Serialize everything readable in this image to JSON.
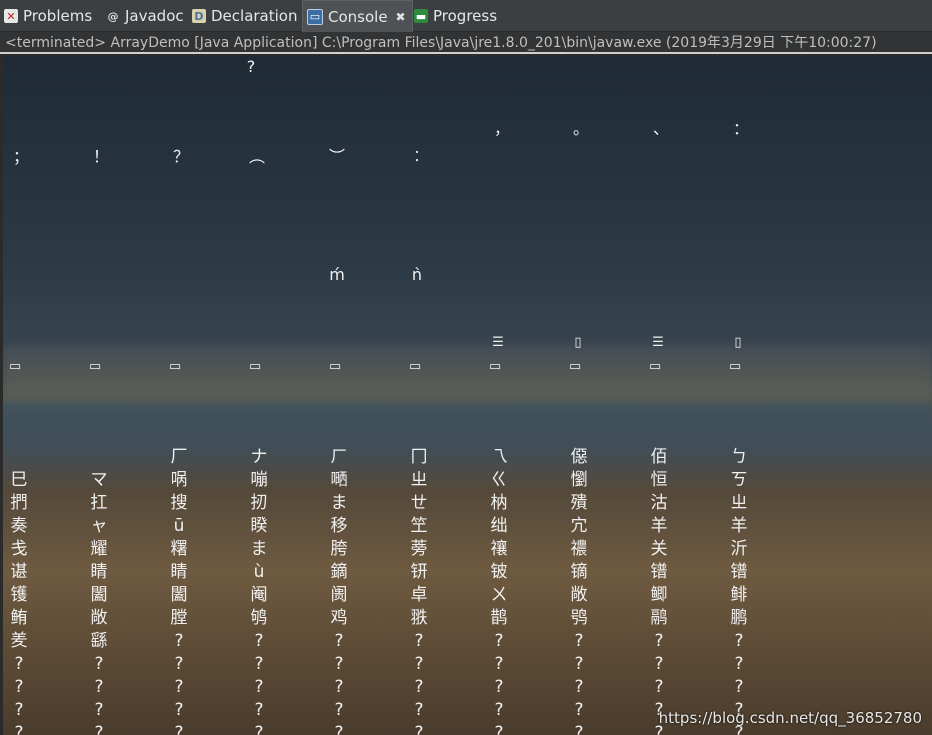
{
  "tabs": [
    {
      "label": "Problems",
      "icon": "problems-icon"
    },
    {
      "label": "Javadoc",
      "icon": "javadoc-icon"
    },
    {
      "label": "Declaration",
      "icon": "declaration-icon"
    },
    {
      "label": "Console",
      "icon": "console-icon",
      "active": true,
      "close": "✖"
    },
    {
      "label": "Progress",
      "icon": "progress-icon"
    }
  ],
  "status_line": "<terminated> ArrayDemo [Java Application] C:\\Program Files\\Java\\jre1.8.0_201\\bin\\javaw.exe (2019年3月29日 下午10:00:27)",
  "output": {
    "punct_row1": [
      "?"
    ],
    "punct_row2": [
      "，",
      "。",
      "、",
      "："
    ],
    "punct_row3": [
      "；",
      "！",
      "？",
      "︵",
      "︶",
      "︰"
    ],
    "accent_row": [
      "ḿ",
      "ǹ"
    ],
    "box_row1": [
      "☰",
      "▯",
      "☰",
      "▯"
    ],
    "box_row2": [
      "▭",
      "▭",
      "▭",
      "▭",
      "▭",
      "▭",
      "▭",
      "▭",
      "▭",
      "▭"
    ],
    "columns": [
      [
        "",
        "巳",
        "捫",
        "奏",
        "戋",
        "谌",
        "镬",
        "鲔",
        "羑",
        "?",
        "?",
        "?",
        "?"
      ],
      [
        "",
        "マ",
        "扛",
        "ャ",
        "耀",
        "睛",
        "闔",
        "敞",
        "繇",
        "?",
        "?",
        "?",
        "?"
      ],
      [
        "厂",
        "㖞",
        "搜",
        "ū",
        "糬",
        "睛",
        "闔",
        "膛",
        "?",
        "?",
        "?",
        "?",
        "?"
      ],
      [
        "ナ",
        "嘣",
        "扨",
        "睽",
        "ま",
        "ù",
        "阉",
        "鸲",
        "?",
        "?",
        "?",
        "?",
        "?"
      ],
      [
        "ㄏ",
        "嗮",
        "ま",
        "移",
        "胯",
        "鏑",
        "阓",
        "鸡",
        "?",
        "?",
        "?",
        "?",
        "?"
      ],
      [
        "冂",
        "ㄓ",
        "ㄝ",
        "笁",
        "蒡",
        "钘",
        "卓",
        "翐",
        "?",
        "?",
        "?",
        "?",
        "?"
      ],
      [
        "乁",
        "ㄍ",
        "枘",
        "绌",
        "禳",
        "铍",
        "ㄨ",
        "鹊",
        "?",
        "?",
        "?",
        "?",
        "?"
      ],
      [
        "僫",
        "懰",
        "殨",
        "宂",
        "禯",
        "镝",
        "敞",
        "鸮",
        "?",
        "?",
        "?",
        "?",
        "?"
      ],
      [
        "佰",
        "恒",
        "沽",
        "羊",
        "关",
        "镨",
        "鲫",
        "鹝",
        "?",
        "?",
        "?",
        "?",
        "?"
      ],
      [
        "ㄅ",
        "ㄎ",
        "ㄓ",
        "羊",
        "沂",
        "镨",
        "鲱",
        "鹏",
        "?",
        "?",
        "?",
        "?",
        "?"
      ]
    ]
  },
  "watermark": "https://blog.csdn.net/qq_36852780"
}
